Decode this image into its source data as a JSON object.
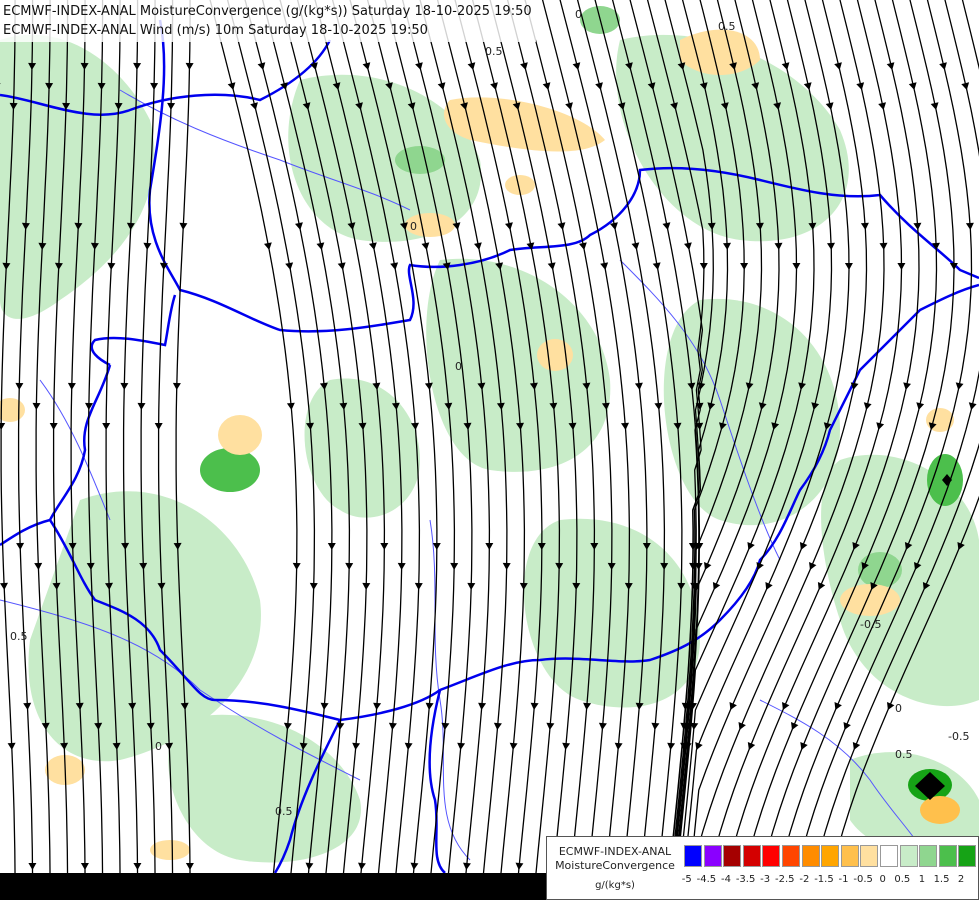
{
  "titles": {
    "line1": "ECMWF-INDEX-ANAL MoistureConvergence (g/(kg*s)) Saturday 18-10-2025 19:50",
    "line2": "ECMWF-INDEX-ANAL Wind (m/s) 10m Saturday 18-10-2025 19:50"
  },
  "legend": {
    "model": "ECMWF-INDEX-ANAL",
    "variable": "MoistureConvergence",
    "unit": "g/(kg*s)",
    "ticks": [
      "-5",
      "-4.5",
      "-4",
      "-3.5",
      "-3",
      "-2.5",
      "-2",
      "-1.5",
      "-1",
      "-0.5",
      "0",
      "0.5",
      "1",
      "1.5",
      "2"
    ],
    "colors": [
      "#0000ff",
      "#8a00ff",
      "#a50000",
      "#d40000",
      "#ff0000",
      "#ff4500",
      "#ff8c00",
      "#ffa500",
      "#ffc04c",
      "#ffe0a0",
      "#ffffff",
      "#c8ecc8",
      "#8fd68f",
      "#4cbf4c",
      "#16a316"
    ]
  },
  "map": {
    "background": "#ffffff",
    "convergence_color": "#c8ecc8",
    "strong_convergence_color": "#4cbf4c",
    "divergence_color": "#ffe0a0",
    "border_color": "#0000ee",
    "river_color": "#5555ff",
    "streamline_color": "#000000",
    "contour_labels": [
      "0",
      "0.5",
      "-0.5",
      "0",
      "0.5",
      "0",
      "0.5",
      "-0.5",
      "0",
      "0.5",
      "0",
      "0.5"
    ]
  }
}
